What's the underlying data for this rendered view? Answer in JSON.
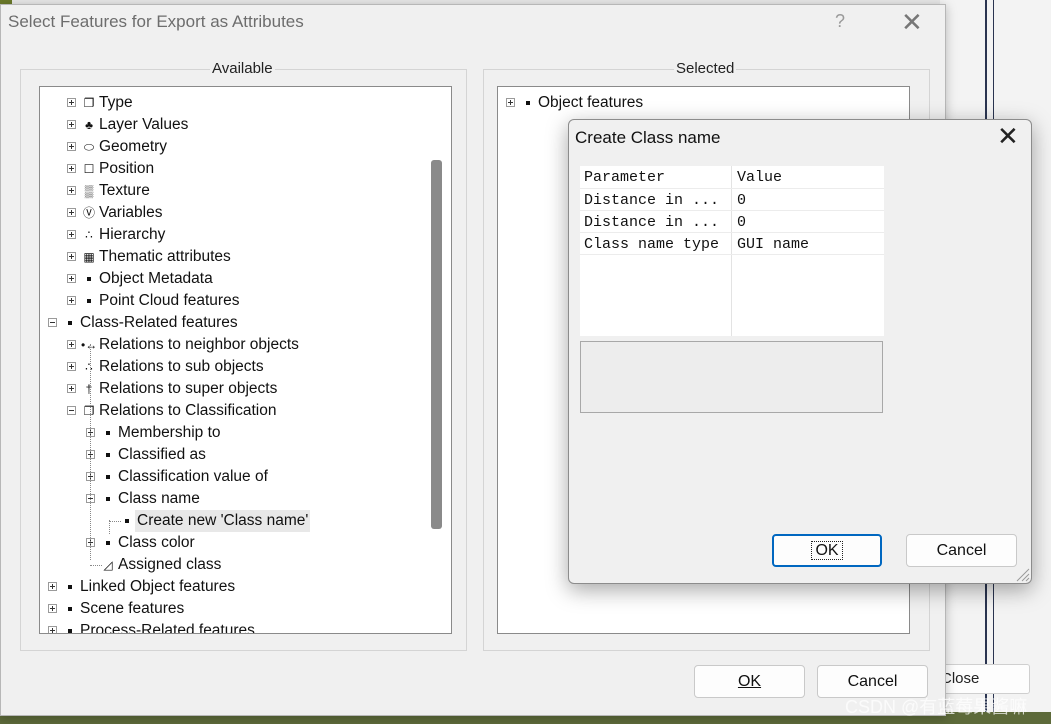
{
  "background": {
    "close_label_partial": "Close"
  },
  "main_dialog": {
    "title": "Select Features for Export as Attributes",
    "help": "?",
    "close": "✕",
    "available_label": "Available",
    "selected_label": "Selected",
    "ok_label": "OK",
    "cancel_label": "Cancel"
  },
  "available_tree": [
    {
      "label": "Type",
      "icon": "type-icon",
      "glyph": "❐"
    },
    {
      "label": "Layer Values",
      "icon": "layer-values-icon",
      "glyph": "♣"
    },
    {
      "label": "Geometry",
      "icon": "geometry-icon",
      "glyph": "⬭"
    },
    {
      "label": "Position",
      "icon": "position-icon",
      "glyph": "☐"
    },
    {
      "label": "Texture",
      "icon": "texture-icon",
      "glyph": "▒"
    },
    {
      "label": "Variables",
      "icon": "variables-icon",
      "glyph": "Ⓥ"
    },
    {
      "label": "Hierarchy",
      "icon": "hierarchy-icon",
      "glyph": "∴"
    },
    {
      "label": "Thematic attributes",
      "icon": "table-icon",
      "glyph": "▦"
    },
    {
      "label": "Object Metadata",
      "icon": "bullet-icon"
    },
    {
      "label": "Point Cloud features",
      "icon": "bullet-icon"
    },
    {
      "label": "Class-Related features",
      "icon": "bullet-icon"
    },
    {
      "label": "Relations to neighbor objects",
      "icon": "neighbor-relations-icon",
      "glyph": "•↔"
    },
    {
      "label": "Relations to sub objects",
      "icon": "sub-relations-icon",
      "glyph": "∴"
    },
    {
      "label": "Relations to super objects",
      "icon": "super-relations-icon",
      "glyph": "†"
    },
    {
      "label": "Relations to Classification",
      "icon": "classification-icon",
      "glyph": "❐"
    },
    {
      "label": "Membership to",
      "icon": "bullet-icon"
    },
    {
      "label": "Classified as",
      "icon": "bullet-icon"
    },
    {
      "label": "Classification value of",
      "icon": "bullet-icon"
    },
    {
      "label": "Class name",
      "icon": "bullet-icon"
    },
    {
      "label": "Create new 'Class name'",
      "icon": "bullet-icon"
    },
    {
      "label": "Class color",
      "icon": "bullet-icon"
    },
    {
      "label": "Assigned class",
      "icon": "chart-icon",
      "glyph": "◿"
    },
    {
      "label": "Linked Object features",
      "icon": "bullet-icon"
    },
    {
      "label": "Scene features",
      "icon": "bullet-icon"
    },
    {
      "label": "Process-Related features",
      "icon": "bullet-icon"
    }
  ],
  "selected_tree": [
    {
      "label": "Object features",
      "icon": "bullet-icon"
    }
  ],
  "create_dialog": {
    "title": "Create Class name",
    "close": "✕",
    "header": {
      "param": "Parameter",
      "value": "Value"
    },
    "rows": [
      {
        "param": "Distance in ...",
        "value": "0"
      },
      {
        "param": "Distance in ...",
        "value": "0"
      },
      {
        "param": "Class name type",
        "value": "GUI name"
      }
    ],
    "ok_label": "OK",
    "cancel_label": "Cancel"
  },
  "watermark": "CSDN @有蓝莓果酱嘛"
}
